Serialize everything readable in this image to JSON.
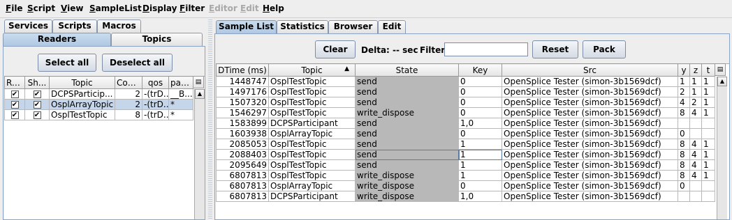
{
  "menu": [
    {
      "label": "File",
      "enabled": true
    },
    {
      "label": "Script",
      "enabled": true
    },
    {
      "label": "View",
      "enabled": true
    },
    {
      "label": "SampleList",
      "enabled": true
    },
    {
      "label": "Display",
      "enabled": true
    },
    {
      "label": "Filter",
      "enabled": true
    },
    {
      "label": "Editor",
      "enabled": false
    },
    {
      "label": "Edit",
      "enabled": false
    },
    {
      "label": "Help",
      "enabled": true
    }
  ],
  "left": {
    "tabs_top": [
      "Services",
      "Scripts",
      "Macros"
    ],
    "tabs_sub": [
      "Readers",
      "Topics"
    ],
    "select_all": "Select all",
    "deselect_all": "Deselect all",
    "columns": [
      "Read",
      "Sh...",
      "Topic",
      "Count",
      "qos",
      "parti..."
    ],
    "rows": [
      {
        "read": "✔",
        "show": "✔",
        "topic": "DCPSParticip...",
        "count": "2",
        "qos": "-(trD...",
        "parti": "__B...",
        "selected": false
      },
      {
        "read": "✔",
        "show": "✔",
        "topic": "OsplArrayTopic",
        "count": "2",
        "qos": "-(trD...",
        "parti": "*",
        "selected": true
      },
      {
        "read": "✔",
        "show": "✔",
        "topic": "OsplTestTopic",
        "count": "8",
        "qos": "-(trD...",
        "parti": "*",
        "selected": false
      }
    ]
  },
  "right": {
    "tabs": [
      "Sample List",
      "Statistics",
      "Browser",
      "Edit"
    ],
    "clear": "Clear",
    "delta": "Delta: -- sec",
    "filter_label": "Filter",
    "filter_value": "",
    "reset": "Reset",
    "pack": "Pack",
    "columns": [
      "DTime (ms)",
      "Topic",
      "State",
      "Key",
      "Src",
      "y",
      "z",
      "t"
    ],
    "sort_indicator": "▲",
    "rows": [
      {
        "dtime": "1448747",
        "topic": "OsplTestTopic",
        "state": "send",
        "key": "0",
        "src": "OpenSplice Tester (simon-3b1569dcf)",
        "y": "1",
        "z": "1",
        "t": "1"
      },
      {
        "dtime": "1497176",
        "topic": "OsplTestTopic",
        "state": "send",
        "key": "0",
        "src": "OpenSplice Tester (simon-3b1569dcf)",
        "y": "2",
        "z": "1",
        "t": "1"
      },
      {
        "dtime": "1507320",
        "topic": "OsplTestTopic",
        "state": "send",
        "key": "0",
        "src": "OpenSplice Tester (simon-3b1569dcf)",
        "y": "4",
        "z": "2",
        "t": "1"
      },
      {
        "dtime": "1546297",
        "topic": "OsplTestTopic",
        "state": "write_dispose",
        "key": "0",
        "src": "OpenSplice Tester (simon-3b1569dcf)",
        "y": "8",
        "z": "4",
        "t": "1"
      },
      {
        "dtime": "1583899",
        "topic": "DCPSParticipant",
        "state": "send",
        "key": "1,0",
        "src": "OpenSplice Tester (simon-3b1569dcf)",
        "y": "",
        "z": "",
        "t": ""
      },
      {
        "dtime": "1603938",
        "topic": "OsplArrayTopic",
        "state": "send",
        "key": "0",
        "src": "OpenSplice Tester (simon-3b1569dcf)",
        "y": "0",
        "z": "",
        "t": ""
      },
      {
        "dtime": "2085053",
        "topic": "OsplTestTopic",
        "state": "send",
        "key": "1",
        "src": "OpenSplice Tester (simon-3b1569dcf)",
        "y": "8",
        "z": "4",
        "t": "1"
      },
      {
        "dtime": "2088403",
        "topic": "OsplTestTopic",
        "state": "send",
        "key": "1",
        "src": "OpenSplice Tester (simon-3b1569dcf)",
        "y": "8",
        "z": "4",
        "t": "1"
      },
      {
        "dtime": "2095649",
        "topic": "OsplTestTopic",
        "state": "send",
        "key": "1",
        "src": "OpenSplice Tester (simon-3b1569dcf)",
        "y": "8",
        "z": "4",
        "t": "1"
      },
      {
        "dtime": "6807813",
        "topic": "OsplTestTopic",
        "state": "write_dispose",
        "key": "1",
        "src": "OpenSplice Tester (simon-3b1569dcf)",
        "y": "8",
        "z": "4",
        "t": "1"
      },
      {
        "dtime": "6807813",
        "topic": "OsplArrayTopic",
        "state": "write_dispose",
        "key": "0",
        "src": "OpenSplice Tester (simon-3b1569dcf)",
        "y": "0",
        "z": "",
        "t": ""
      },
      {
        "dtime": "6807813",
        "topic": "DCPSParticipant",
        "state": "write_dispose",
        "key": "1,0",
        "src": "OpenSplice Tester (simon-3b1569dcf)",
        "y": "",
        "z": "",
        "t": ""
      }
    ]
  },
  "colors": {
    "selected_row": "#c6d6ea",
    "state_cell": "#b8b8b8",
    "tab_selected": "#b0c8e2"
  },
  "icons": {
    "column_control": "column-control-icon",
    "scroll_up": "scroll-up-arrow-icon",
    "sort": "sort-ascending-icon"
  }
}
